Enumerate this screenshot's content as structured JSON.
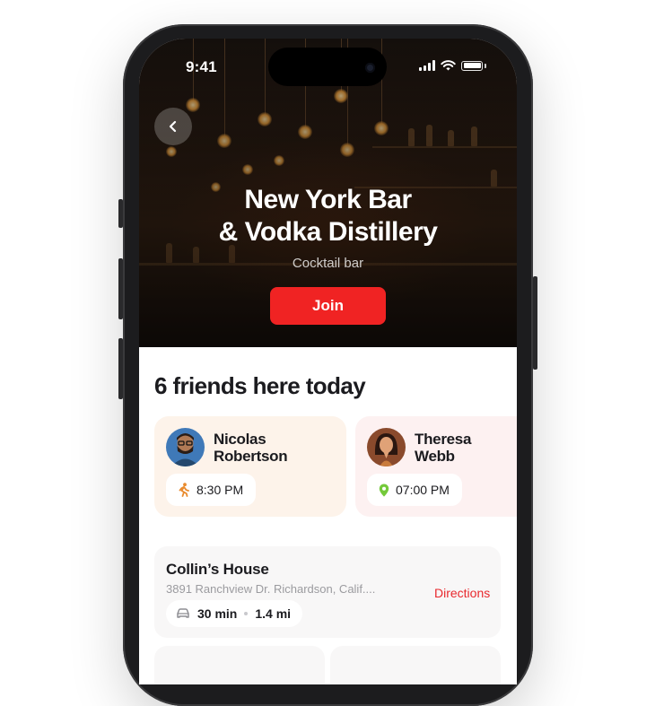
{
  "status_bar": {
    "time": "9:41"
  },
  "venue": {
    "title_line1": "New York Bar",
    "title_line2": "& Vodka Distillery",
    "category": "Cocktail bar",
    "join_label": "Join"
  },
  "friends": {
    "heading": "6 friends here today",
    "items": [
      {
        "first": "Nicolas",
        "last": "Robertson",
        "time": "8:30 PM",
        "status_icon": "walking-icon",
        "card_color": "#fdf3ea"
      },
      {
        "first": "Theresa",
        "last": "Webb",
        "time": "07:00 PM",
        "status_icon": "location-pin-icon",
        "card_color": "#fdf1f1"
      }
    ]
  },
  "place": {
    "name": "Collin’s House",
    "address": "3891 Ranchview Dr. Richardson, Calif....",
    "directions_label": "Directions",
    "duration": "30 min",
    "distance": "1.4 mi"
  },
  "colors": {
    "accent": "#f02323",
    "directions": "#e8282d",
    "walk_icon": "#e98b2e",
    "pin_icon": "#74c93a"
  }
}
